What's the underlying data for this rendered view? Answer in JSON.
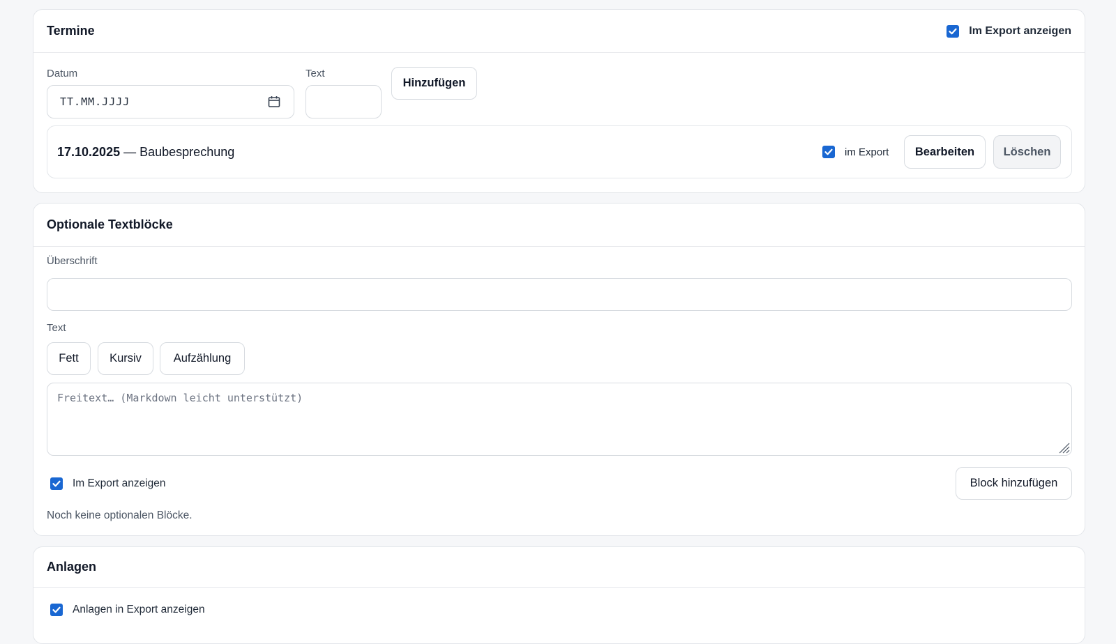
{
  "termine": {
    "title": "Termine",
    "export_label": "Im Export anzeigen",
    "date_label": "Datum",
    "date_placeholder": "TT.MM.JJJJ",
    "text_label": "Text",
    "add_button": "Hinzufügen",
    "entries": [
      {
        "date": "17.10.2025",
        "separator": "—",
        "text": "Baubesprechung",
        "export_label": "im Export",
        "edit_button": "Bearbeiten",
        "delete_button": "Löschen"
      }
    ]
  },
  "textbloecke": {
    "title": "Optionale Textblöcke",
    "heading_label": "Überschrift",
    "heading_value": "",
    "text_label": "Text",
    "format_buttons": [
      "Fett",
      "Kursiv",
      "Aufzählung"
    ],
    "textarea_placeholder": "Freitext… (Markdown leicht unterstützt)",
    "export_label": "Im Export anzeigen",
    "add_block_button": "Block hinzufügen",
    "empty_note": "Noch keine optionalen Blöcke."
  },
  "anlagen": {
    "title": "Anlagen",
    "export_label": "Anlagen in Export anzeigen"
  },
  "colors": {
    "accent": "#1967d2",
    "background": "#f6f7f9",
    "card": "#ffffff",
    "border": "#e3e6ea"
  },
  "icons": {
    "checkbox": "checkmark-icon",
    "date_picker": "calendar-icon",
    "resize": "resize-grip-icon"
  }
}
